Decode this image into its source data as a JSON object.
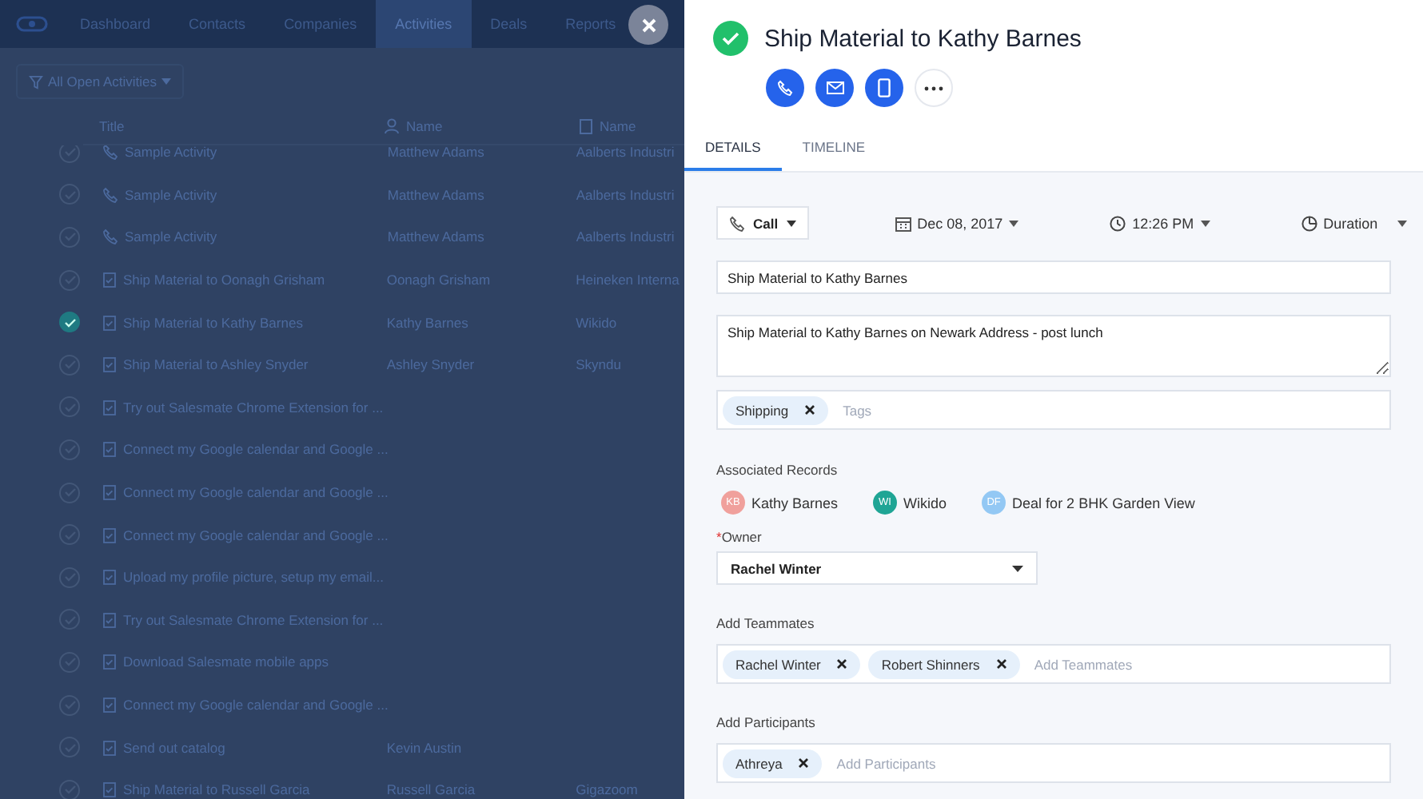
{
  "nav": {
    "items": [
      {
        "label": "Dashboard",
        "selected": false
      },
      {
        "label": "Contacts",
        "selected": false
      },
      {
        "label": "Companies",
        "selected": false
      },
      {
        "label": "Activities",
        "selected": true
      },
      {
        "label": "Deals",
        "selected": false
      },
      {
        "label": "Reports",
        "selected": false
      }
    ]
  },
  "filter": {
    "label": "All Open Activities"
  },
  "table": {
    "columns": [
      {
        "label": "Title",
        "kind": "plain"
      },
      {
        "label": "Name",
        "kind": "person"
      },
      {
        "label": "Name",
        "kind": "company"
      }
    ],
    "rows": [
      {
        "kind": "call",
        "title": "Sample Activity",
        "name": "Matthew Adams",
        "company": "Aalberts Industri",
        "completed": false
      },
      {
        "kind": "call",
        "title": "Sample Activity",
        "name": "Matthew Adams",
        "company": "Aalberts Industri",
        "completed": false
      },
      {
        "kind": "call",
        "title": "Sample Activity",
        "name": "Matthew Adams",
        "company": "Aalberts Industri",
        "completed": false
      },
      {
        "kind": "task",
        "title": "Ship Material to Oonagh Grisham",
        "name": "Oonagh Grisham",
        "company": "Heineken Interna",
        "completed": false
      },
      {
        "kind": "task",
        "title": "Ship Material to Kathy Barnes",
        "name": "Kathy Barnes",
        "company": "Wikido",
        "completed": true
      },
      {
        "kind": "task",
        "title": "Ship Material to Ashley Snyder",
        "name": "Ashley Snyder",
        "company": "Skyndu",
        "completed": false
      },
      {
        "kind": "task",
        "title": "Try out Salesmate Chrome Extension for ...",
        "name": "",
        "company": "",
        "completed": false
      },
      {
        "kind": "task",
        "title": "Connect my Google calendar and Google ...",
        "name": "",
        "company": "",
        "completed": false
      },
      {
        "kind": "task",
        "title": "Connect my Google calendar and Google ...",
        "name": "",
        "company": "",
        "completed": false
      },
      {
        "kind": "task",
        "title": "Connect my Google calendar and Google ...",
        "name": "",
        "company": "",
        "completed": false
      },
      {
        "kind": "task",
        "title": "Upload my profile picture, setup my email...",
        "name": "",
        "company": "",
        "completed": false
      },
      {
        "kind": "task",
        "title": "Try out Salesmate Chrome Extension for ...",
        "name": "",
        "company": "",
        "completed": false
      },
      {
        "kind": "task",
        "title": "Download Salesmate mobile apps",
        "name": "",
        "company": "",
        "completed": false
      },
      {
        "kind": "task",
        "title": "Connect my Google calendar and Google ...",
        "name": "",
        "company": "",
        "completed": false
      },
      {
        "kind": "task",
        "title": "Send out catalog",
        "name": "Kevin Austin",
        "company": "",
        "completed": false
      },
      {
        "kind": "task",
        "title": "Ship Material to Russell Garcia",
        "name": "Russell Garcia",
        "company": "Gigazoom",
        "completed": false
      }
    ]
  },
  "detail": {
    "title": "Ship Material to Kathy Barnes",
    "completed": true,
    "tabs": [
      {
        "label": "DETAILS",
        "selected": true
      },
      {
        "label": "TIMELINE",
        "selected": false
      }
    ],
    "form": {
      "type": "Call",
      "date": "Dec 08, 2017",
      "time": "12:26 PM",
      "duration": "Duration",
      "subject": "Ship Material to Kathy Barnes",
      "description": "Ship Material to Kathy Barnes on Newark Address - post lunch",
      "tags": [
        "Shipping"
      ],
      "tags_placeholder": "Tags",
      "associated_label": "Associated Records",
      "associated": [
        {
          "initials": "KB",
          "name": "Kathy Barnes",
          "color": "#f0a09c"
        },
        {
          "initials": "WI",
          "name": "Wikido",
          "color": "#1fa595"
        },
        {
          "initials": "DF",
          "name": "Deal for 2 BHK Garden View",
          "color": "#93c8f4"
        }
      ],
      "owner_required_mark": "*",
      "owner_label": "Owner",
      "owner": "Rachel Winter",
      "teammates_label": "Add Teammates",
      "teammates": [
        "Rachel Winter",
        "Robert Shinners"
      ],
      "teammates_placeholder": "Add Teammates",
      "participants_label": "Add Participants",
      "participants": [
        "Athreya"
      ],
      "participants_placeholder": "Add Participants"
    }
  }
}
